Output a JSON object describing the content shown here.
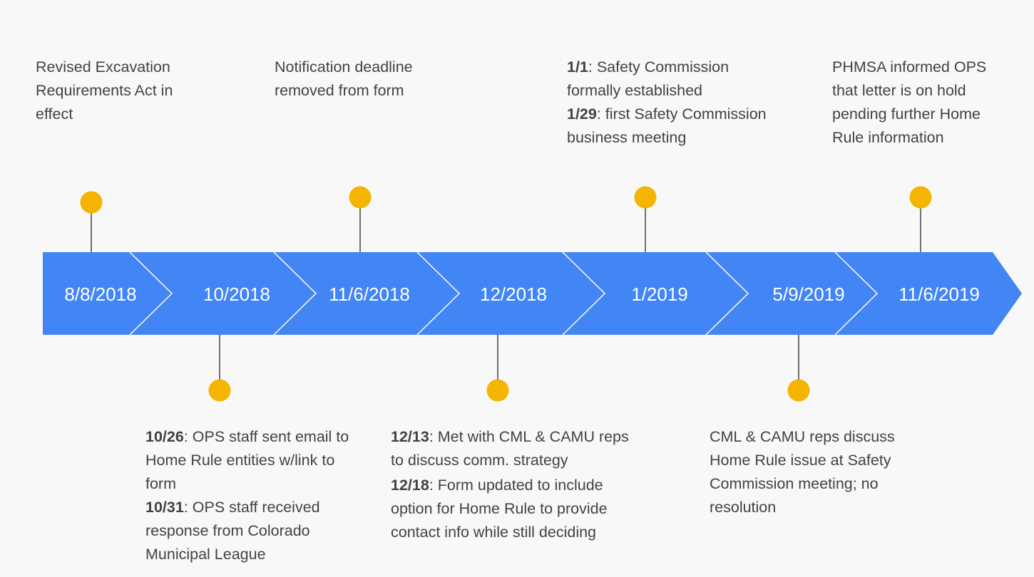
{
  "colors": {
    "arrow_fill": "#4285f4",
    "chevron_line": "#ffffff",
    "marker": "#f4b400",
    "connector": "#424242",
    "background": "#f8f8f8"
  },
  "segments": [
    {
      "label": "8/8/2018"
    },
    {
      "label": "10/2018"
    },
    {
      "label": "11/6/2018"
    },
    {
      "label": "12/2018"
    },
    {
      "label": "1/2019"
    },
    {
      "label": "5/9/2019"
    },
    {
      "label": "11/6/2019"
    }
  ],
  "events": {
    "e1": {
      "lines": [
        {
          "text": "Revised Excavation Requirements Act in effect"
        }
      ]
    },
    "e2": {
      "lines": [
        {
          "date": "10/26",
          "text": ": OPS staff sent email to Home Rule entities w/link to form"
        },
        {
          "date": "10/31",
          "text": ": OPS staff received response from Colorado Municipal League"
        }
      ]
    },
    "e3": {
      "lines": [
        {
          "text": "Notification deadline removed from form"
        }
      ]
    },
    "e4": {
      "lines": [
        {
          "date": "12/13",
          "text": ": Met with CML & CAMU reps to discuss comm. strategy"
        },
        {
          "date": "12/18",
          "text": ": Form updated to include option for Home Rule to provide contact info while still deciding"
        }
      ]
    },
    "e5": {
      "lines": [
        {
          "date": "1/1",
          "text": ": Safety Commission formally established"
        },
        {
          "date": "1/29",
          "text": ": first Safety Commission business meeting"
        }
      ]
    },
    "e6": {
      "lines": [
        {
          "text": "CML & CAMU reps discuss Home Rule issue at Safety Commission meeting; no resolution"
        }
      ]
    },
    "e7": {
      "lines": [
        {
          "text": "PHMSA informed OPS that letter is on hold pending further Home Rule information"
        }
      ]
    }
  }
}
